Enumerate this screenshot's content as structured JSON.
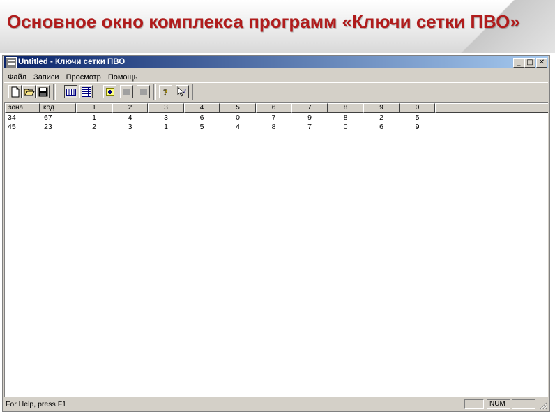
{
  "slide": {
    "title": "Основное окно комплекса программ «Ключи сетки ПВО»"
  },
  "window": {
    "title": "Untitled - Ключи сетки ПВО",
    "minimize_label": "_",
    "maximize_label": "□",
    "close_label": "✕"
  },
  "menu": {
    "items": [
      {
        "label": "Файл"
      },
      {
        "label": "Записи"
      },
      {
        "label": "Просмотр"
      },
      {
        "label": "Помощь"
      }
    ]
  },
  "toolbar": {
    "buttons": [
      {
        "icon": "new-document-icon"
      },
      {
        "icon": "open-folder-icon"
      },
      {
        "icon": "save-disk-icon"
      },
      {
        "icon": "table-view-icon",
        "pressed": true
      },
      {
        "icon": "grid-view-icon"
      },
      {
        "icon": "add-record-icon"
      },
      {
        "icon": "disabled-button-icon"
      },
      {
        "icon": "disabled-button-icon"
      },
      {
        "icon": "help-icon"
      },
      {
        "icon": "context-help-icon"
      }
    ]
  },
  "table": {
    "columns": [
      "зона",
      "код",
      "1",
      "2",
      "3",
      "4",
      "5",
      "6",
      "7",
      "8",
      "9",
      "0"
    ],
    "rows": [
      [
        "34",
        "67",
        "1",
        "4",
        "3",
        "6",
        "0",
        "7",
        "9",
        "8",
        "2",
        "5"
      ],
      [
        "45",
        "23",
        "2",
        "3",
        "1",
        "5",
        "4",
        "8",
        "7",
        "0",
        "6",
        "9"
      ]
    ]
  },
  "statusbar": {
    "help_text": "For Help, press F1",
    "num_indicator": "NUM"
  },
  "colors": {
    "title_red": "#b01c1c",
    "titlebar_start": "#0a246a",
    "titlebar_end": "#a6caf0",
    "window_face": "#d4d0c8"
  }
}
